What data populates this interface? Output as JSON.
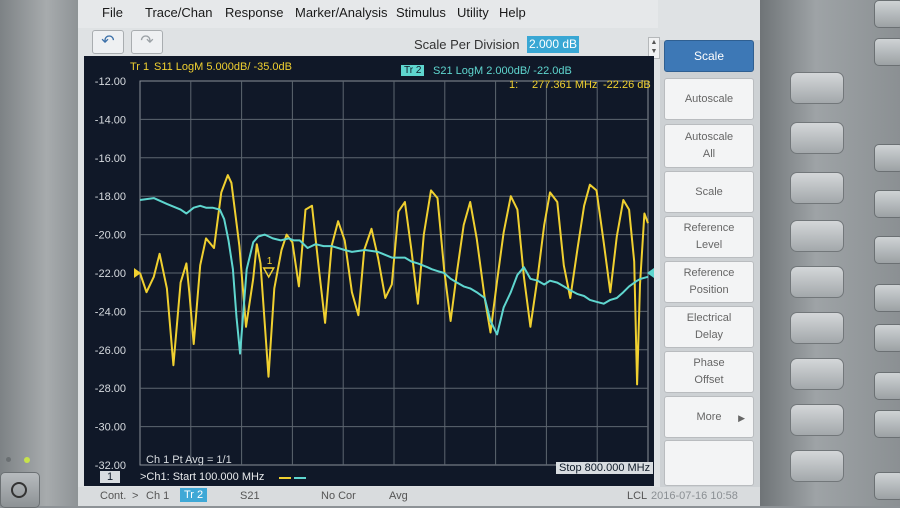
{
  "menu": [
    "File",
    "Trace/Chan",
    "Response",
    "Marker/Analysis",
    "Stimulus",
    "Utility",
    "Help"
  ],
  "toolbar": {
    "undo_icon": "undo-icon",
    "redo_icon": "redo-icon",
    "scale_label": "Scale Per Division",
    "scale_value": "2.000 dB"
  },
  "trace1": {
    "label": "Tr 1",
    "desc": "S11 LogM 5.000dB/ -35.0dB",
    "color": "#f0d030"
  },
  "trace2": {
    "label": "Tr 2",
    "desc": "S21 LogM 2.000dB/ -22.0dB",
    "color": "#5fd6cf"
  },
  "marker": {
    "num": "1:",
    "freq": "277.361 MHz",
    "value": "-22.26 dB",
    "flag": "1"
  },
  "ticks": [
    "-12.00",
    "-14.00",
    "-16.00",
    "-18.00",
    "-20.00",
    "-22.00",
    "-24.00",
    "-26.00",
    "-28.00",
    "-30.00",
    "-32.00"
  ],
  "avg": "Ch 1 Pt Avg = 1/1",
  "channel_num": "1",
  "start": ">Ch1: Start  100.000 MHz",
  "stop": "Stop  800.000 MHz",
  "softkeys": [
    {
      "label": "Scale",
      "active": true
    },
    {
      "label": "Autoscale",
      "active": false
    },
    {
      "label": "Autoscale\nAll",
      "active": false
    },
    {
      "label": "Scale",
      "active": false
    },
    {
      "label": "Reference\nLevel",
      "active": false
    },
    {
      "label": "Reference\nPosition",
      "active": false
    },
    {
      "label": "Electrical\nDelay",
      "active": false
    },
    {
      "label": "Phase\nOffset",
      "active": false
    },
    {
      "label": "More",
      "active": false
    },
    {
      "label": "",
      "active": false
    }
  ],
  "status": {
    "cont": "Cont.",
    "ch": "Ch 1",
    "tr": "Tr 2",
    "s": "S21",
    "cor": "No Cor",
    "avg": "Avg",
    "lcl": "LCL",
    "time": "2016-07-16 10:58"
  },
  "chart_data": {
    "type": "line",
    "x_range": [
      100,
      800
    ],
    "x_unit": "MHz",
    "y_range_grid": [
      -32,
      -12
    ],
    "series": [
      {
        "name": "S11",
        "color": "#f0d030",
        "x": [
          100,
          109,
          119,
          127,
          137,
          146,
          156,
          164,
          168,
          174,
          183,
          191,
          202,
          212,
          221,
          226,
          237,
          246,
          256,
          261,
          266,
          277,
          285,
          295,
          302,
          310,
          319,
          328,
          337,
          346,
          355,
          364,
          373,
          382,
          392,
          401,
          409,
          419,
          428,
          438,
          447,
          456,
          465,
          474,
          483,
          491,
          501,
          510,
          519,
          528,
          537,
          546,
          555,
          564,
          575,
          583,
          592,
          601,
          611,
          620,
          629,
          638,
          648,
          657,
          665,
          675,
          684,
          693,
          703,
          712,
          720,
          729,
          739,
          748,
          757,
          766,
          774,
          781,
          785,
          789,
          795,
          800
        ],
        "y": [
          -22.0,
          -23.0,
          -22.2,
          -21.0,
          -22.8,
          -26.8,
          -22.5,
          -21.5,
          -23.0,
          -25.7,
          -21.6,
          -20.2,
          -20.7,
          -17.8,
          -16.9,
          -17.3,
          -20.6,
          -24.8,
          -22.3,
          -20.5,
          -21.5,
          -27.4,
          -22.8,
          -20.8,
          -20.0,
          -20.4,
          -22.7,
          -18.7,
          -18.5,
          -21.6,
          -24.6,
          -20.6,
          -19.3,
          -20.3,
          -23.0,
          -24.2,
          -20.8,
          -19.7,
          -21.2,
          -23.3,
          -22.6,
          -18.8,
          -18.3,
          -20.8,
          -23.6,
          -20.0,
          -17.7,
          -18.1,
          -21.8,
          -24.5,
          -21.9,
          -19.5,
          -18.3,
          -20.2,
          -23.3,
          -25.1,
          -22.4,
          -19.9,
          -18.0,
          -18.7,
          -22.2,
          -24.8,
          -22.2,
          -19.5,
          -17.8,
          -18.3,
          -21.6,
          -23.3,
          -20.7,
          -18.5,
          -17.4,
          -17.7,
          -20.4,
          -23.0,
          -20.1,
          -18.2,
          -18.7,
          -21.4,
          -27.8,
          -22.6,
          -18.9,
          -19.4
        ]
      },
      {
        "name": "S21",
        "color": "#5fd6cf",
        "x": [
          100,
          119,
          137,
          156,
          164,
          174,
          183,
          191,
          200,
          210,
          216,
          222,
          228,
          233,
          238,
          247,
          256,
          263,
          272,
          283,
          294,
          305,
          312,
          320,
          331,
          342,
          353,
          364,
          373,
          382,
          392,
          410,
          428,
          447,
          465,
          474,
          483,
          496,
          502,
          510,
          519,
          528,
          537,
          546,
          555,
          564,
          575,
          583,
          592,
          601,
          611,
          620,
          629,
          638,
          648,
          657,
          665,
          675,
          684,
          693,
          703,
          712,
          720,
          729,
          739,
          748,
          757,
          766,
          774,
          785,
          790,
          800
        ],
        "y": [
          -18.2,
          -18.1,
          -18.4,
          -18.7,
          -18.9,
          -18.6,
          -18.5,
          -18.6,
          -18.6,
          -18.7,
          -19.2,
          -20.3,
          -21.8,
          -24.3,
          -26.2,
          -21.8,
          -20.4,
          -20.1,
          -20.0,
          -20.2,
          -20.3,
          -20.2,
          -20.3,
          -20.3,
          -20.7,
          -20.5,
          -20.6,
          -20.6,
          -20.7,
          -20.8,
          -20.9,
          -20.8,
          -20.9,
          -21.2,
          -21.2,
          -21.4,
          -21.5,
          -21.7,
          -21.8,
          -21.9,
          -22.0,
          -22.3,
          -22.5,
          -22.7,
          -22.8,
          -23.0,
          -23.3,
          -24.5,
          -25.2,
          -23.8,
          -23.0,
          -22.1,
          -21.7,
          -22.3,
          -22.4,
          -22.6,
          -22.4,
          -22.5,
          -22.7,
          -22.9,
          -23.1,
          -23.2,
          -23.4,
          -23.5,
          -23.6,
          -23.4,
          -23.3,
          -23.0,
          -22.7,
          -22.4,
          -22.3,
          -22.2
        ]
      }
    ],
    "marker": {
      "x": 277.361,
      "y": -22.26
    }
  }
}
